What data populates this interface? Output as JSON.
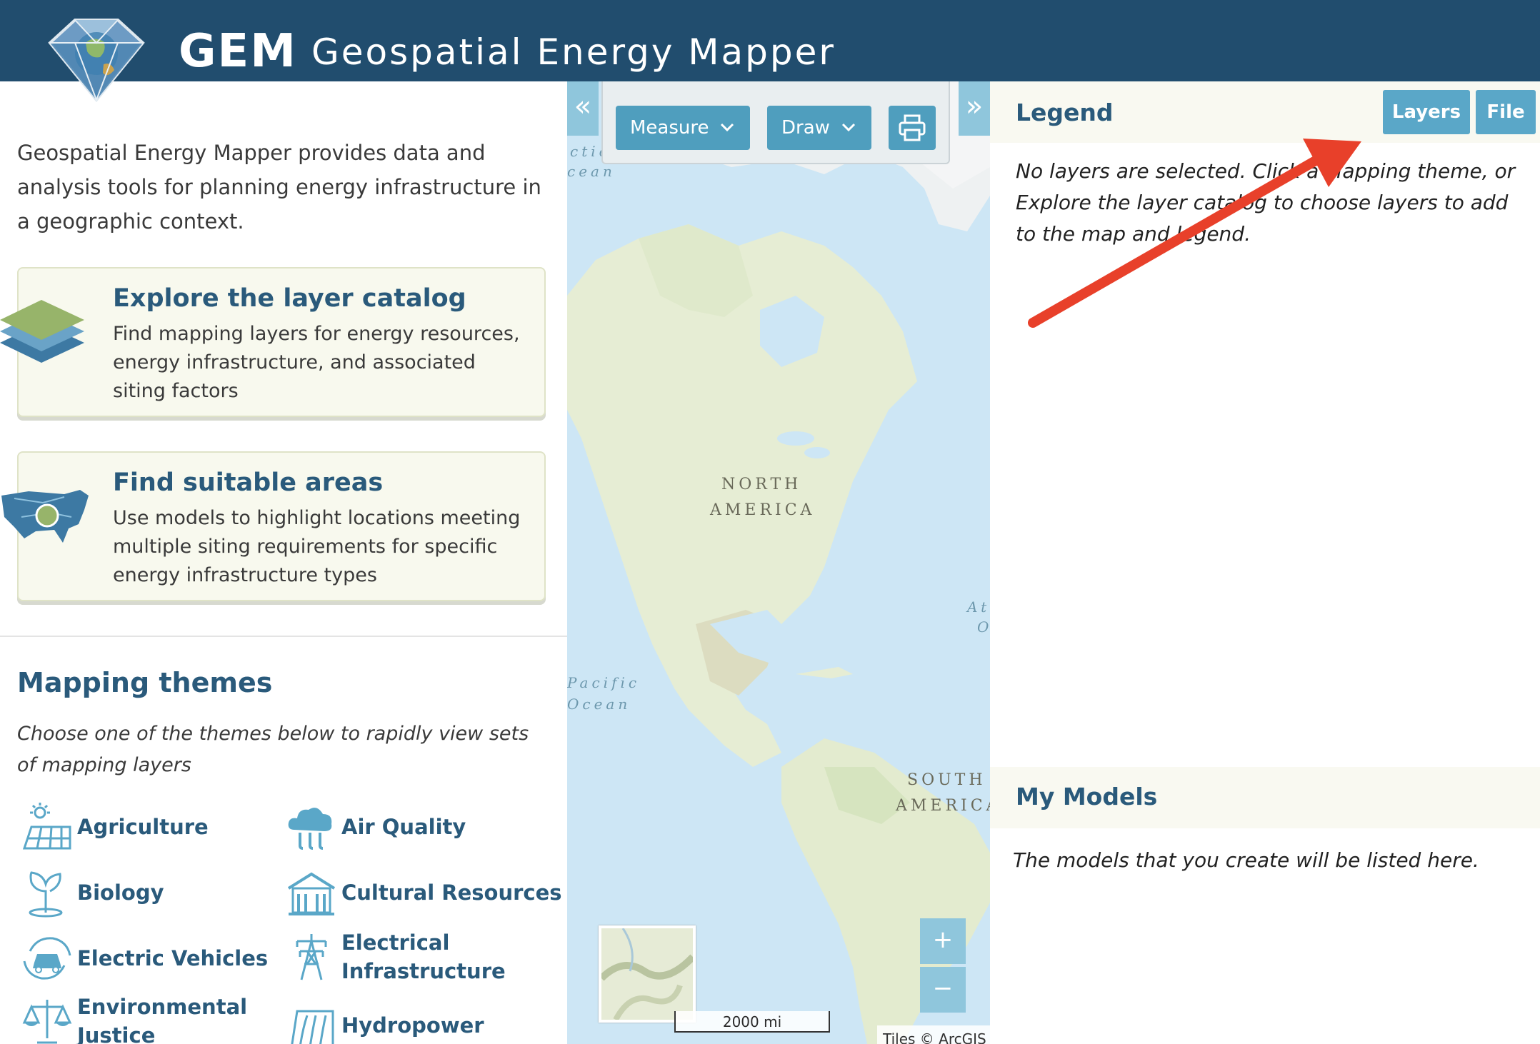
{
  "header": {
    "brand": "GEM",
    "subtitle": "Geospatial Energy Mapper"
  },
  "left_panel": {
    "intro": "Geospatial Energy Mapper provides data and analysis tools for planning energy infrastructure in a geographic context.",
    "cards": [
      {
        "title": "Explore the layer catalog",
        "description": "Find mapping layers for energy resources, energy infrastructure, and associated siting factors",
        "icon": "layers-icon"
      },
      {
        "title": "Find suitable areas",
        "description": "Use models to highlight locations meeting multiple siting requirements for specific energy infrastructure types",
        "icon": "us-map-icon"
      }
    ],
    "themes_title": "Mapping themes",
    "themes_hint": "Choose one of the themes below to rapidly view sets of mapping layers",
    "themes": [
      {
        "label": "Agriculture",
        "icon": "agriculture-icon"
      },
      {
        "label": "Air Quality",
        "icon": "air-quality-icon"
      },
      {
        "label": "Biology",
        "icon": "biology-icon"
      },
      {
        "label": "Cultural Resources",
        "icon": "cultural-resources-icon"
      },
      {
        "label": "Electric Vehicles",
        "icon": "electric-vehicles-icon"
      },
      {
        "label": "Electrical Infrastructure",
        "icon": "electrical-infrastructure-icon"
      },
      {
        "label": "Environmental Justice",
        "icon": "environmental-justice-icon"
      },
      {
        "label": "Hydropower",
        "icon": "hydropower-icon"
      }
    ]
  },
  "map": {
    "toolbar": {
      "measure": "Measure",
      "draw": "Draw"
    },
    "labels": {
      "north_america_1": "NORTH",
      "north_america_2": "AMERICA",
      "south_america_1": "SOUTH",
      "south_america_2": "AMERICA",
      "pacific_1": "Pacific",
      "pacific_2": "Ocean",
      "arctic_1": "ctic",
      "arctic_2": "cean",
      "atlantic_1": "At",
      "atlantic_2": "O"
    },
    "zoom_in": "+",
    "zoom_out": "−",
    "scale": "2000 mi",
    "attribution": "Tiles © ArcGIS"
  },
  "right_panel": {
    "legend_title": "Legend",
    "layers_button": "Layers",
    "file_button": "File",
    "legend_message": "No layers are selected. Click a Mapping theme, or Explore the layer catalog to choose layers to add to the map and legend.",
    "models_title": "My Models",
    "models_message": "The models that you create will be listed here."
  },
  "colors": {
    "header": "#214d6e",
    "accent": "#5aa7c8",
    "title_text": "#2a5a7b",
    "annotation_arrow": "#e8402a"
  }
}
